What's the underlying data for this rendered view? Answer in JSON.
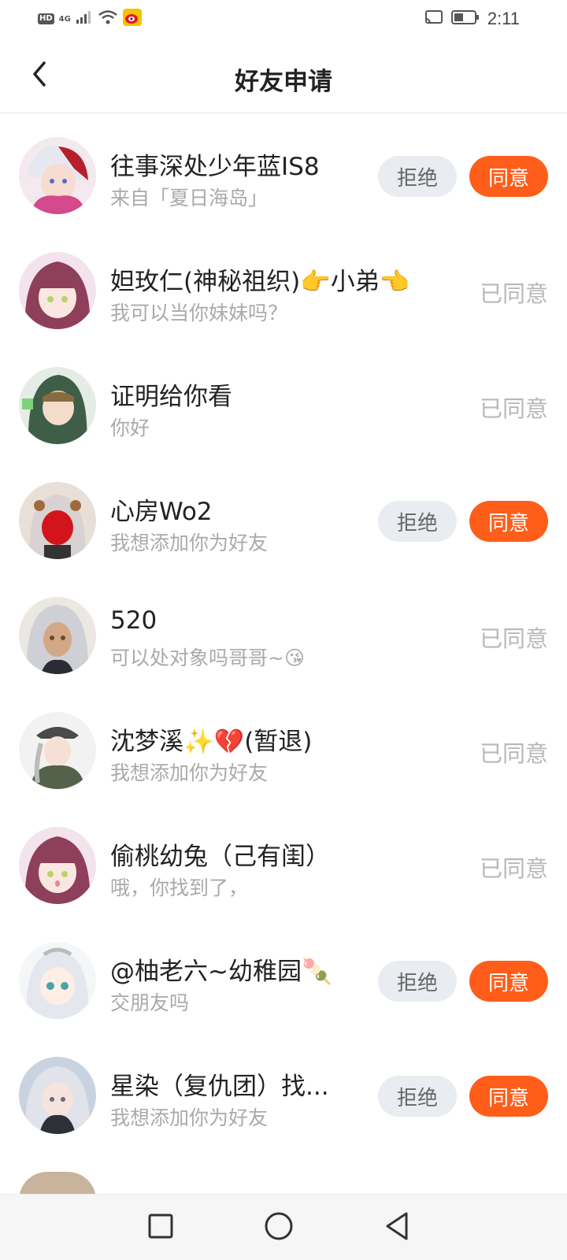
{
  "status_bar": {
    "hd": "HD",
    "network": "4G",
    "time": "2:11"
  },
  "header": {
    "title": "好友申请"
  },
  "buttons": {
    "reject": "拒绝",
    "accept": "同意",
    "agreed": "已同意"
  },
  "requests": [
    {
      "name": "往事深处少年蓝IS8",
      "message": "来自「夏日海岛」",
      "status": "pending"
    },
    {
      "name": "妲玫仁(神秘祖织)👉小弟👈",
      "message": "我可以当你妹妹吗？",
      "status": "agreed"
    },
    {
      "name": "证明给你看",
      "message": "你好",
      "status": "agreed"
    },
    {
      "name": "心房Wo2",
      "message": "我想添加你为好友",
      "status": "pending"
    },
    {
      "name": "520",
      "message": "可以处对象吗哥哥~😘",
      "status": "agreed"
    },
    {
      "name": "沈梦溪✨💔(暂退)",
      "message": "我想添加你为好友",
      "status": "agreed"
    },
    {
      "name": "偷桃幼兔（己有闺）",
      "message": "哦，你找到了，",
      "status": "agreed"
    },
    {
      "name": "@柚老六~幼稚园🍡",
      "message": "交朋友吗",
      "status": "pending"
    },
    {
      "name": "星染（复仇团）找...",
      "message": "我想添加你为好友",
      "status": "pending"
    }
  ],
  "colors": {
    "accent": "#ff5d1a",
    "reject_bg": "#e9ecf1",
    "muted_text": "#aaaaaa"
  }
}
